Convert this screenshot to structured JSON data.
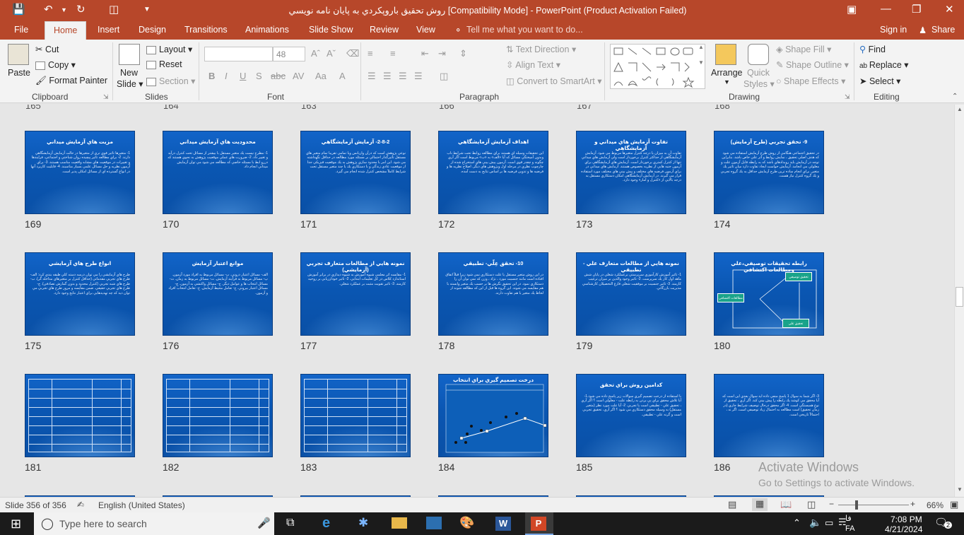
{
  "window": {
    "title": "روش تحقيق  باروپكردي به پايان نامه نويسي [Compatibility Mode] - PowerPoint (Product Activation Failed)"
  },
  "tabs": {
    "file": "File",
    "items": [
      "Home",
      "Insert",
      "Design",
      "Transitions",
      "Animations",
      "Slide Show",
      "Review",
      "View"
    ],
    "tell_me": "Tell me what you want to do...",
    "sign_in": "Sign in",
    "share": "Share"
  },
  "ribbon": {
    "clipboard": {
      "label": "Clipboard",
      "paste": "Paste",
      "cut": "Cut",
      "copy": "Copy",
      "format_painter": "Format Painter"
    },
    "slides": {
      "label": "Slides",
      "new_slide": "New",
      "new_slide2": "Slide",
      "layout": "Layout",
      "reset": "Reset",
      "section": "Section"
    },
    "font": {
      "label": "Font",
      "size": "48"
    },
    "paragraph": {
      "label": "Paragraph",
      "text_direction": "Text Direction",
      "align_text": "Align Text",
      "convert_smartart": "Convert to SmartArt"
    },
    "drawing": {
      "label": "Drawing",
      "arrange": "Arrange",
      "quick": "Quick",
      "styles": "Styles",
      "shape_fill": "Shape Fill",
      "shape_outline": "Shape Outline",
      "shape_effects": "Shape Effects"
    },
    "editing": {
      "label": "Editing",
      "find": "Find",
      "replace": "Replace",
      "select": "Select"
    }
  },
  "top_numbers": [
    "165",
    "164",
    "163",
    "166",
    "167",
    "168"
  ],
  "slides": [
    {
      "num": "169",
      "title": "مزيت هاي آزمايش ميداني",
      "body": "1- متغيرها تاثير قوي تري از متغيرها در حالت آزمايش آزمايشگاهي دارند. 2- براي مطالعه تاثير پيچيده روان شناختي و اجتماعي، فرايندها و تغييرات در موقعيت هاي مشابه واقعيت مناسب هستند. 3- براي آزمون نظريه و حل مسائل علمي بسيار مناسبند. 4- قابليت كاربرد آنها در انواع گسترده اي از مسائل امكان پذير است."
    },
    {
      "num": "170",
      "title": "محدوديت هاي آزمايش ميداني",
      "body": "1- مطرح نيست يك متغير مستقل با بيشتر از مسائل تحت كنترل درآيد و تغيير داد. 2- ضرورت هاي عملي موقعيت پژوهش به نحوي هستند كه دررو ابط با مسئله خاصي كه مطالعه مي شود مي توان آزمايش ميداني انجام داد."
    },
    {
      "num": "171",
      "title": "2-8-2- آزمايش آزمايشگاهي",
      "body": "نوعي پژوهش است كه درآن واريانس ويا تمامي تقريبا تمام متغير هاي مستقل تاثيرگذار احتمالي بر مسئله مورد مطالعه در حداقل نگهداشته مي شود. اين امر با محدود سازي پژوهش به يك موقعيت فيزيكي جدا از موقعيت عادي زندگي و با دستكاري يك يا چند متغير مستقل تحت شرايط كاملاً مشخص كنترل شده انجام مي گيرد."
    },
    {
      "num": "172",
      "title": "اهداف آزمايش آزمايشگاهي",
      "body": "اين تحقيقات وسيله اي هستند براي مطالعه روابط تحت شرايط ناب وبدون آميختگي مسائل كه آيا «الف» به «ب» مربوط است اگر آري چگونه و چقدر قوي است. آزمون پيش بيني هاي استخراج شده از چارچوب نظري در مرحله اول ويژوهش هاي ديگر. اصلاح نظريه ها و فرضيه ها و تدوين فرضيه ها بر اساس نتايج به دست آمده."
    },
    {
      "num": "173",
      "title": "تفاوت  آزمايش هاي ميداني و آزمايشگاهي",
      "body": "تفاوت آن به ميزان يا درجه كنترل متغيرها مربوط مي شود. آزمايش آزمايشگاهي از حداكثر كنترل برخوردار است ولي آزمايش هاي ميداني تنها از كنترل كمتري برخوردار است. آزمايش هاي آزمايشگاهي براي آزمون جنبه هايي از نظريه بخصوص هستند. آزمايش هاي ميداني در براي آزمون فرضيه هاي مختلف و پيش بيني هاي مختلف مورد استفاده قرار مي گيرند. در آزمايش آزمايشگاهي امكان دستكاري مستقل به درجه بالايي از «كنترل و آمار» وجود دارد."
    },
    {
      "num": "174",
      "title": "9- تحقق تجربي (طرح آزمايش)",
      "body": "در تحقيق اجتماعي هنگامي از روش طرح آزمايش استفاده مي شود كه هدف اصلي تحقيق ، نمايش روابط و اثر علي خاص باشد. بنابراين توجه در آزمايش بايد رويدادهاي باشد كه به رابطه قابل آزمون علت و معلولي مي انجامد. آزمايش خواست ايجاد تفاوت دارد ميان تاثير يك متغير. براي انجام ساده ترين طرح آزمايش حداقل به يك گروه تجربي و يك گروه كنترل نياز هست."
    },
    {
      "num": "175",
      "title": "انواع طرح هاي آزمايشي",
      "body": "طرح هاي آزمايشي را مي توان درسه دسته كلي طبقه بندي كرد: الف- طرح هاي تجربي مقدماتي (حداقل كنترل بر متغيرهاي مداخله گر). ب- طرح هاي شبه تجربي (كنترل محدود و بدون گمارش تصادفي). ج- طرح هاي تجربي حقيقي. ضمن مقايسه و مرور طرح هاي تجربي مي توان ديد كه چه تهديدهايي براي اعتبار نتايج وجود دارد."
    },
    {
      "num": "176",
      "title": "موانع اعتبار آزمايش",
      "body": "الف- مسائل اعتبار دروني. ب- مسائل مربوط به افراد مورد آزمون. پ- مسائل مربوط به فرآيند آزمايش. ت- مسائل مربوط به زمان. ث- مسائل انتخاب ها و عوامل ديگر. ج- مسائل واكنشي به آزمون. چ- مسائل اعتبار بيروني. ح- تعامل محيط آزمايش. خ- تعامل انتخاب افراد و آزمون."
    },
    {
      "num": "177",
      "title": "نمونه هايي از مطالعات متعارف تجربي (آزمايشي)",
      "body": "1- مقايسه اثر معلمي شيوه آموزش به شيوه ديداري در برابر آموزش استاندارد كلاس در كل تعليمات ابتدايي. 2- تاثير خودارزيابي بر روحيه كارمند. 3- تاثير تقويت مثبت بر عملكرد شغلي."
    },
    {
      "num": "178",
      "title": "10- تحقق عِلّي- تطبيقي",
      "body": "در اين روش متغير مستقل يا علت دستكاري نمي شود زيرا قبلاً اتفاق افتاده است مانند جنسيت مورد ، نژاد ، وزن كه نمي توان آن را دستكاري نمود. در اين تحقيق نگرش ها بر حسب يك متغير وابسته با هم مقايسه مي شوند. اين گروه ها قبل از اين كه مطالعه شوند از لحاظ يك متغير با هم تفاوت دارند."
    },
    {
      "num": "179",
      "title": "نمونه هايي از مطالعات متعارف علي - تطبيقي",
      "body": "1- تاثير آموزش كارآموزي سرپرستي برعملكرد شغلي در پايان شش ماهه اول كار يك سرپرست. 2- تاثير وجود والدين بر ميزان ترغيب كارمند. 3- تاثير جنسيت بر موفقيت شغلي فارغ التحصيلان كارشناسي مديريت بازرگاني."
    },
    {
      "num": "180",
      "title": "رابطه تحقيقات توصيفي،علي ومطالعات اكتشافي",
      "body": ""
    },
    {
      "num": "181",
      "title": "",
      "body": ""
    },
    {
      "num": "182",
      "title": "",
      "body": ""
    },
    {
      "num": "183",
      "title": "",
      "body": ""
    },
    {
      "num": "184",
      "title": "درخت تصميم گيري براي انتخاب روشهاي تحقيق",
      "body": ""
    },
    {
      "num": "185",
      "title": "كدامين روش براي تحقق",
      "body": "با استفاده از درخت تصميم گيري سوالات زير پاسخ داده مي شود.1- آيا تلاش محقق براي پي بردن به رابطه علت - معلولي است ؟ اگر آري ، تحقيق علي - تطبيقي است يا تجربي. 2- آيا علت مورد نظر (متغير مستقل) به وسيله محقق دستكاري مي شود ؟ اگر آري، تحقيق تجربي است و گرنه علي - تطبيقي."
    },
    {
      "num": "186",
      "title": "",
      "body": "3- اگر شما به سوال 1 پاسخ منفي داده ايد سوال بعدي اين است كه آيا محقق مي كوشد يك رابطه را پيش بيني كند. اگر آري ، تحقيق از نوع همبستگي است. 4- اگر محقق درحال توصيف شرايط جاري (در زمان تحقيق) است مطالعه به احتمال زياد توصيفي است. اگر نه ، احتمالاً تاريخي است."
    }
  ],
  "diagram180": {
    "a": "تحقيق توصيفي",
    "b": "مطالعات اكتشافي",
    "c": "تحقيق علي"
  },
  "status": {
    "slide": "Slide 356 of 356",
    "language": "English (United States)",
    "zoom": "66%"
  },
  "watermark": {
    "line1": "Activate Windows",
    "line2": "Go to Settings to activate Windows."
  },
  "taskbar": {
    "search": "Type here to search",
    "lang": "FA",
    "lang2": "فا",
    "time": "7:08 PM",
    "date": "4/21/2024",
    "notif": "2"
  }
}
